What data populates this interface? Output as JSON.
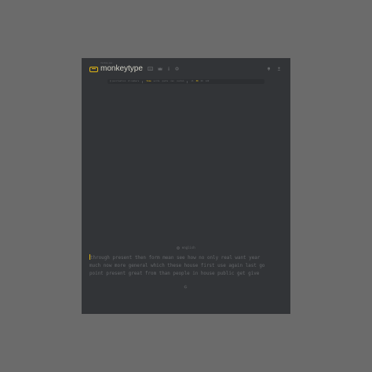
{
  "header": {
    "logo_sub": "monkey see",
    "logo_text": "monkeytype",
    "nav_icons": [
      "keyboard-icon",
      "crown-icon",
      "info-icon",
      "gear-icon"
    ],
    "right_icons": [
      "bell-icon",
      "user-icon"
    ]
  },
  "config": {
    "items": [
      {
        "label": "@ punctuation",
        "active": false
      },
      {
        "label": "# numbers",
        "active": false
      },
      {
        "label": "time",
        "active": true
      },
      {
        "label": "words",
        "active": false
      },
      {
        "label": "quote",
        "active": false
      },
      {
        "label": "zen",
        "active": false
      },
      {
        "label": "custom",
        "active": false
      },
      {
        "label": "15",
        "active": false
      },
      {
        "label": "30",
        "active": true
      },
      {
        "label": "60",
        "active": false
      },
      {
        "label": "120",
        "active": false
      }
    ]
  },
  "test": {
    "language": "english",
    "lines": [
      "through present then form mean see how no only real want year",
      "much now more general which these house first use again last go",
      "point present great from than people in house public get give"
    ],
    "accent": "#e2b714"
  },
  "colors": {
    "background": "#323437",
    "sub": "#646669",
    "text": "#d1d0c5",
    "main": "#e2b714"
  }
}
